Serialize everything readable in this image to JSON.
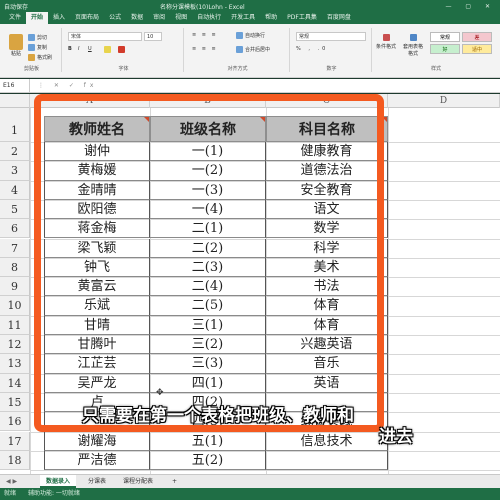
{
  "window": {
    "autosave_label": "自动保存",
    "title": "名称分课模板(10)Lohn - Excel",
    "controls": "— ▢ ✕"
  },
  "menu": [
    "文件",
    "开始",
    "插入",
    "页面布局",
    "公式",
    "数据",
    "审阅",
    "视图",
    "自动执行",
    "开发工具",
    "帮助",
    "PDF工具集",
    "百度网盘"
  ],
  "menu_active": "开始",
  "ribbon": {
    "paste_label": "粘贴",
    "cut_label": "剪切",
    "copy_label": "复制",
    "format_painter_label": "格式刷",
    "clipboard_group": "剪贴板",
    "font_name": "宋体",
    "font_size": "10",
    "font_group": "字体",
    "align_group": "对齐方式",
    "wrap_label": "自动换行",
    "merge_label": "合并后居中",
    "number_format": "常规",
    "number_group": "数字",
    "cond_format_label": "条件格式",
    "table_format_label": "套用表格格式",
    "style_normal": "常规",
    "style_bad": "差",
    "style_good": "好",
    "style_neutral": "适中",
    "styles_group": "样式"
  },
  "formula_bar": {
    "name_box": "E16",
    "fx_icons": "⋮ ✕ ✓ fx"
  },
  "sheet": {
    "columns": [
      "A",
      "B",
      "C",
      "D"
    ],
    "rows": [
      "1",
      "2",
      "3",
      "4",
      "5",
      "6",
      "7",
      "8",
      "9",
      "10",
      "11",
      "12",
      "13",
      "14",
      "15",
      "16",
      "17",
      "18"
    ],
    "headers": [
      "教师姓名",
      "班级名称",
      "科目名称"
    ],
    "data": [
      [
        "谢仲",
        "一(1)",
        "健康教育"
      ],
      [
        "黄梅媛",
        "一(2)",
        "道德法治"
      ],
      [
        "金晴晴",
        "一(3)",
        "安全教育"
      ],
      [
        "欧阳德",
        "一(4)",
        "语文"
      ],
      [
        "蒋金梅",
        "二(1)",
        "数学"
      ],
      [
        "梁飞颖",
        "二(2)",
        "科学"
      ],
      [
        "钟飞",
        "二(3)",
        "美术"
      ],
      [
        "黄富云",
        "二(4)",
        "书法"
      ],
      [
        "乐斌",
        "二(5)",
        "体育"
      ],
      [
        "甘晴",
        "三(1)",
        "体育"
      ],
      [
        "甘腾叶",
        "三(2)",
        "兴趣英语"
      ],
      [
        "江芷芸",
        "三(3)",
        "音乐"
      ],
      [
        "吴严龙",
        "四(1)",
        "英语"
      ],
      [
        "卢",
        "四(2)",
        ""
      ],
      [
        "",
        "四(3)",
        "综合实践"
      ],
      [
        "谢耀海",
        "五(1)",
        "信息技术"
      ],
      [
        "严洁德",
        "五(2)",
        ""
      ]
    ]
  },
  "subtitle": {
    "line1": "只需要在第一个表格把班级、教师和",
    "line2": "进去"
  },
  "tabs": [
    "数据录入",
    "分课表",
    "课程分配表"
  ],
  "tab_active": "数据录入",
  "tab_nav": "◀ ▶",
  "tab_add": "+",
  "status": {
    "ready": "就绪",
    "accessibility": "辅助功能: 一切就绪"
  },
  "colors": {
    "accent": "#1f6e45",
    "highlight_frame": "#f45a20",
    "header_fill": "#bfbfbf"
  }
}
